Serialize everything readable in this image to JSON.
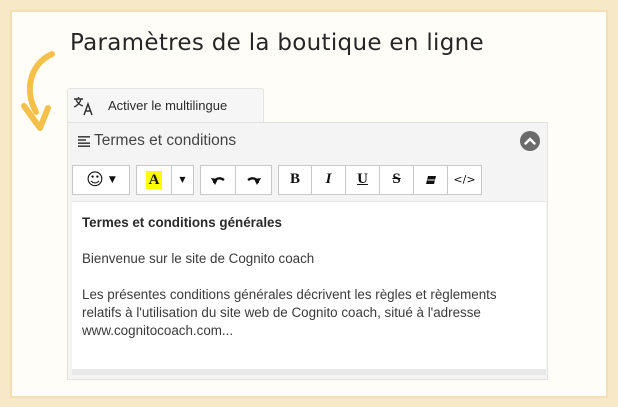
{
  "page": {
    "heading": "Paramètres de la boutique en ligne"
  },
  "tab": {
    "label": "Activer le multilingue",
    "icon": "translate-icon"
  },
  "panel": {
    "title": "Termes et conditions",
    "icon": "text-lines-icon",
    "collapse_icon": "chevron-up-icon"
  },
  "toolbar": {
    "emoji": "☺",
    "text_color_label": "A",
    "bold": "B",
    "italic": "I",
    "underline": "U",
    "strike": "S",
    "code": "</>",
    "highlight_color": "#ffff00"
  },
  "editor": {
    "heading": "Termes et conditions générales",
    "paragraph1": "Bienvenue sur le site de Cognito coach",
    "paragraph2": "Les présentes conditions générales décrivent les règles et règlements relatifs à l'utilisation du site web de Cognito coach, situé à l'adresse www.cognitocoach.com..."
  },
  "colors": {
    "arrow": "#f5c04a",
    "background": "#f7e8c8"
  }
}
